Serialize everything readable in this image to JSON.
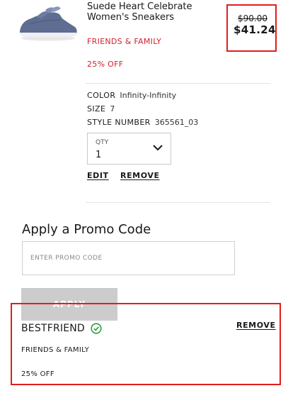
{
  "cart_item": {
    "name": "Suede Heart Celebrate Women's Sneakers",
    "promo_tag": "FRIENDS & FAMILY",
    "discount_label": "25% OFF",
    "price_original": "$90.00",
    "price_sale": "$41.24",
    "details": {
      "color": {
        "label": "COLOR",
        "value": "Infinity-Infinity"
      },
      "size": {
        "label": "SIZE",
        "value": "7"
      },
      "style": {
        "label": "STYLE NUMBER",
        "value": "365561_03"
      }
    },
    "qty": {
      "label": "QTY",
      "value": "1"
    },
    "edit_label": "EDIT",
    "remove_label": "REMOVE",
    "image_icon": "sneaker-product-image"
  },
  "promo": {
    "title": "Apply a Promo Code",
    "placeholder": "ENTER PROMO CODE",
    "apply_label": "APPLY",
    "applied": {
      "code": "BESTFRIEND",
      "status_icon": "check-circle-icon",
      "remove_label": "REMOVE",
      "type": "FRIENDS & FAMILY",
      "discount": "25% OFF"
    }
  },
  "colors": {
    "accent_red": "#d3202f",
    "highlight_border": "#e11e1e",
    "success_green": "#1e9c3a",
    "disabled_button": "#cccccc"
  }
}
